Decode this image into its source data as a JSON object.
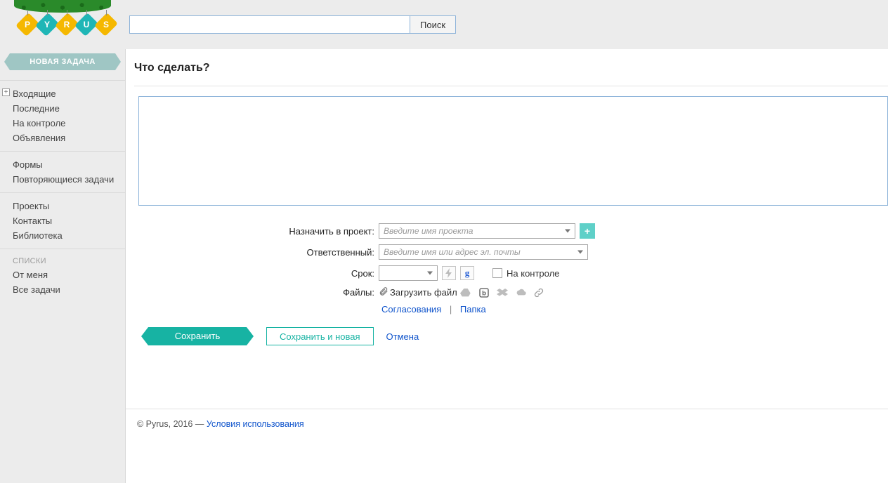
{
  "logo": {
    "letters": [
      "P",
      "Y",
      "R",
      "U",
      "S"
    ]
  },
  "search": {
    "placeholder": "",
    "button": "Поиск"
  },
  "sidebar": {
    "new_task": "НОВАЯ ЗАДАЧА",
    "group1": [
      {
        "label": "Входящие",
        "expandable": true
      },
      {
        "label": "Последние"
      },
      {
        "label": "На контроле"
      },
      {
        "label": "Объявления"
      }
    ],
    "group2": [
      {
        "label": "Формы"
      },
      {
        "label": "Повторяющиеся задачи"
      }
    ],
    "group3": [
      {
        "label": "Проекты"
      },
      {
        "label": "Контакты"
      },
      {
        "label": "Библиотека"
      }
    ],
    "lists_heading": "СПИСКИ",
    "group4": [
      {
        "label": "От меня"
      },
      {
        "label": "Все задачи"
      }
    ]
  },
  "page": {
    "title": "Что сделать?",
    "project_label": "Назначить в проект:",
    "project_placeholder": "Введите имя проекта",
    "responsible_label": "Ответственный:",
    "responsible_placeholder": "Введите имя или адрес эл. почты",
    "due_label": "Срок:",
    "on_control": "На контроле",
    "files_label": "Файлы:",
    "upload": "Загрузить файл",
    "approvals": "Согласования",
    "folder": "Папка",
    "save": "Сохранить",
    "save_new": "Сохранить и новая",
    "cancel": "Отмена"
  },
  "footer": {
    "copyright": "© Pyrus, 2016 — ",
    "terms": "Условия использования"
  }
}
